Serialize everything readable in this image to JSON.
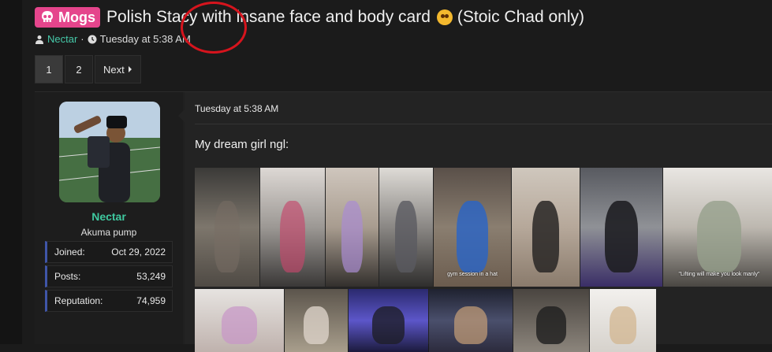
{
  "thread": {
    "prefix": "Mogs",
    "title": "Polish Stacy with insane face and body card",
    "title_suffix": "(Stoic Chad only)",
    "author": "Nectar",
    "separator": "·",
    "date": "Tuesday at 5:38 AM"
  },
  "pagination": {
    "pages": [
      "1",
      "2"
    ],
    "current": "1",
    "next_label": "Next"
  },
  "user": {
    "name": "Nectar",
    "title": "Akuma pump",
    "stats": [
      {
        "label": "Joined:",
        "value": "Oct 29, 2022"
      },
      {
        "label": "Posts:",
        "value": "53,249"
      },
      {
        "label": "Reputation:",
        "value": "74,959"
      }
    ]
  },
  "post": {
    "date": "Tuesday at 5:38 AM",
    "text": "My dream girl ngl:",
    "image_captions": [
      "gym session in a hat",
      "\"Lifting will make you look manly\""
    ]
  },
  "colors": {
    "prefix_bg": "#e5458c",
    "author": "#46c9a9",
    "username": "#3fc89f",
    "stat_accent": "#3f55a8",
    "annotation": "#d6141d"
  }
}
